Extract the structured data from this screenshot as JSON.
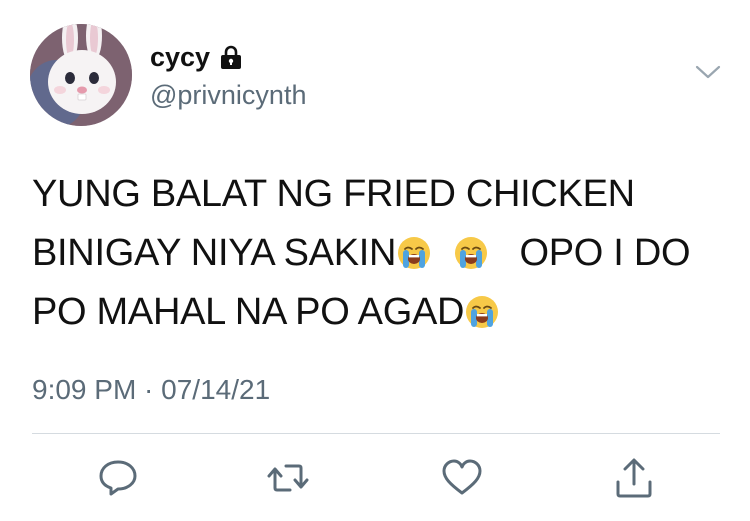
{
  "tweet": {
    "display_name": "cycy",
    "handle": "@privnicynth",
    "protected_icon": "lock-icon",
    "text_lines": [
      "YUNG BALAT NG FRIED CHICKEN",
      "BINIGAY NIYA SAKIN",
      "OPO I DO",
      "PO MAHAL NA PO AGAD"
    ],
    "emoji": "loudly-crying-face",
    "timestamp": "9:09 PM · 07/14/21"
  },
  "actions": {
    "reply_icon": "reply-icon",
    "retweet_icon": "retweet-icon",
    "like_icon": "heart-icon",
    "share_icon": "share-icon"
  },
  "colors": {
    "text": "#111111",
    "secondary": "#5b6b78",
    "divider": "#d5dbe0",
    "icon": "#5b6b78"
  }
}
